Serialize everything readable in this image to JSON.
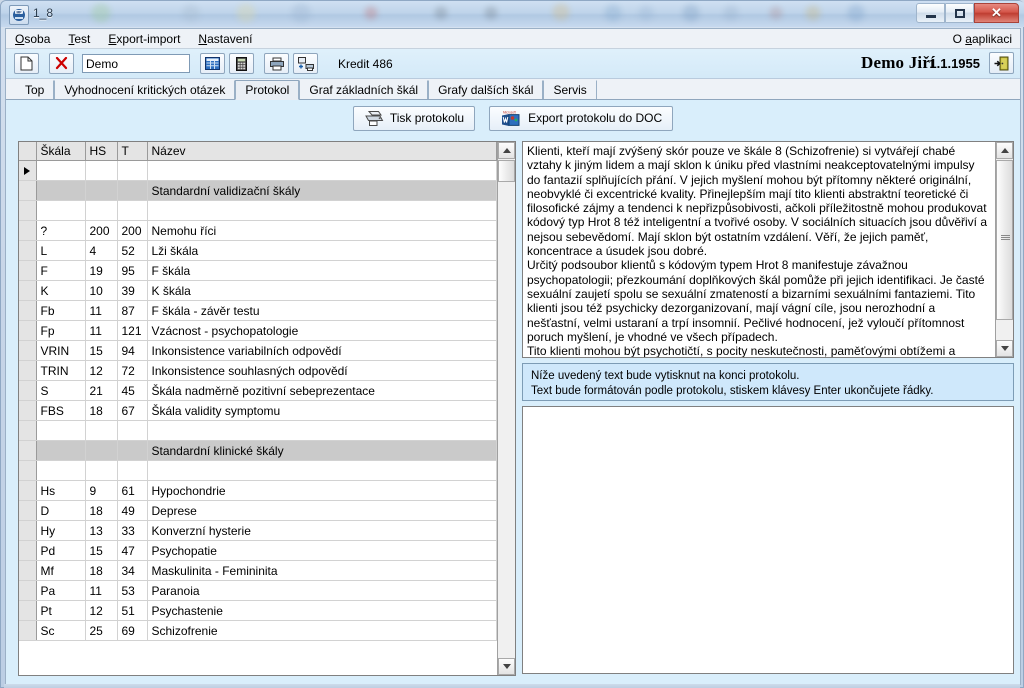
{
  "window": {
    "title": "1_8",
    "app_icon": "mmpi-app-icon",
    "minimize_label": "minimize-icon",
    "maximize_label": "maximize-icon",
    "close_label": "✕"
  },
  "menubar": {
    "items": [
      {
        "label": "Osoba",
        "accel": "O"
      },
      {
        "label": "Test",
        "accel": "T"
      },
      {
        "label": "Export-import",
        "accel": "E"
      },
      {
        "label": "Nastavení",
        "accel": "N"
      }
    ],
    "right_item": "O aplikaci"
  },
  "toolbar": {
    "new_icon": "new-document-icon",
    "delete_icon": "delete-cross-icon",
    "person_value": "Demo",
    "person_placeholder": "Demo",
    "grid_icon": "table-grid-icon",
    "calc_icon": "calculator-icon",
    "print_icon": "printer-icon",
    "print_setup_icon": "printer-setup-icon",
    "credit_label": "Kredit 486",
    "client_name": "Demo Jiří",
    "client_dob": "1.1.1955",
    "exit_icon": "exit-door-icon"
  },
  "tabs": [
    {
      "label": "Top",
      "active": false
    },
    {
      "label": "Vyhodnocení kritických otázek",
      "active": false
    },
    {
      "label": "Protokol",
      "active": true
    },
    {
      "label": "Graf základních škál",
      "active": false
    },
    {
      "label": "Grafy dalších škál",
      "active": false
    },
    {
      "label": "Servis",
      "active": false
    }
  ],
  "actions": {
    "print_protocol": {
      "label": "Tisk protokolu",
      "icon": "printer-icon"
    },
    "export_doc": {
      "label": "Export protokolu do DOC",
      "icon": "msword-icon"
    }
  },
  "grid": {
    "columns": [
      "Škála",
      "HS",
      "T",
      "Název"
    ],
    "rows": [
      {
        "type": "current",
        "scale": "",
        "hs": "",
        "t": "",
        "name": ""
      },
      {
        "type": "section",
        "scale": "",
        "hs": "",
        "t": "",
        "name": "Standardní validizační škály"
      },
      {
        "type": "blank",
        "scale": "",
        "hs": "",
        "t": "",
        "name": ""
      },
      {
        "type": "data",
        "scale": "?",
        "hs": "200",
        "t": "200",
        "name": "Nemohu říci"
      },
      {
        "type": "data",
        "scale": "L",
        "hs": "4",
        "t": "52",
        "name": "Lži škála"
      },
      {
        "type": "data",
        "scale": "F",
        "hs": "19",
        "t": "95",
        "name": "F škála"
      },
      {
        "type": "data",
        "scale": "K",
        "hs": "10",
        "t": "39",
        "name": "K škála"
      },
      {
        "type": "data",
        "scale": "Fb",
        "hs": "11",
        "t": "87",
        "name": "F škála - závěr testu"
      },
      {
        "type": "data",
        "scale": "Fp",
        "hs": "11",
        "t": "121",
        "name": "Vzácnost - psychopatologie"
      },
      {
        "type": "data",
        "scale": "VRIN",
        "hs": "15",
        "t": "94",
        "name": "Inkonsistence variabilních odpovědí"
      },
      {
        "type": "data",
        "scale": "TRIN",
        "hs": "12",
        "t": "72",
        "name": "Inkonsistence souhlasných odpovědí"
      },
      {
        "type": "data",
        "scale": "S",
        "hs": "21",
        "t": "45",
        "name": "Škála nadměrně pozitivní sebeprezentace"
      },
      {
        "type": "data",
        "scale": "FBS",
        "hs": "18",
        "t": "67",
        "name": "Škála validity symptomu"
      },
      {
        "type": "blank",
        "scale": "",
        "hs": "",
        "t": "",
        "name": ""
      },
      {
        "type": "section",
        "scale": "",
        "hs": "",
        "t": "",
        "name": "Standardní klinické škály"
      },
      {
        "type": "blank",
        "scale": "",
        "hs": "",
        "t": "",
        "name": ""
      },
      {
        "type": "data",
        "scale": "Hs",
        "hs": "9",
        "t": "61",
        "name": "Hypochondrie"
      },
      {
        "type": "data",
        "scale": "D",
        "hs": "18",
        "t": "49",
        "name": "Deprese"
      },
      {
        "type": "data",
        "scale": "Hy",
        "hs": "13",
        "t": "33",
        "name": "Konverzní hysterie"
      },
      {
        "type": "data",
        "scale": "Pd",
        "hs": "15",
        "t": "47",
        "name": "Psychopatie"
      },
      {
        "type": "data",
        "scale": "Mf",
        "hs": "18",
        "t": "34",
        "name": "Maskulinita - Femininita"
      },
      {
        "type": "data",
        "scale": "Pa",
        "hs": "11",
        "t": "53",
        "name": "Paranoia"
      },
      {
        "type": "data",
        "scale": "Pt",
        "hs": "12",
        "t": "51",
        "name": "Psychastenie"
      },
      {
        "type": "data",
        "scale": "Sc",
        "hs": "25",
        "t": "69",
        "name": "Schizofrenie"
      }
    ]
  },
  "memo": {
    "paragraphs": [
      "Klienti, kteří mají zvýšený skór pouze ve škále 8 (Schizofrenie) si vytvářejí chabé vztahy k jiným lidem a mají sklon k úniku před vlastními neakceptovatelnými impulsy do fantazií splňujících přání. V jejich myšlení mohou být přítomny některé originální, neobvyklé či excentrické kvality. Přinejlepším mají tito klienti abstraktní teoretické či filosofické zájmy a tendenci k nepřizpůsobivosti, ačkoli příležitostně mohou produkovat kódový typ Hrot 8 též inteligentní a tvořivé osoby. V sociálních situacích jsou důvěřiví a nejsou sebevědomí. Mají sklon být ostatním vzdálení. Věří, že jejich paměť, koncentrace a úsudek jsou dobré.",
      "Určitý podsoubor klientů s kódovým typem Hrot 8 manifestuje závažnou psychopatologii; přezkoumání doplňkových škál pomůže při jejich identifikaci. Je časté sexuální zaujetí spolu se sexuální zmateností a bizarními sexuálními fantaziemi. Tito klienti jsou též psychicky dezorganizovaní, mají vágní cíle, jsou nerozhodní a nešťastní, velmi ustaraní a trpí insomnií. Pečlivé hodnocení, jež vyloučí přítomnost poruch myšlení, je vhodné ve všech případech.",
      "Tito klienti mohou být psychotičtí, s pocity neskutečnosti, paměťovými obtížemi a zmatení či s bizarními myšlenkami a přesvědčeními. Jsou možné halucinace, psychomotorická retardace a stažení se. V anamnéze těchto klientů je běžná psychiatrická hospitalizace. Chronická a charakterologická povaha problémů reprezentovaných v kódovém typu Hrot 8 nevěstí rovněž nic"
    ]
  },
  "infobox": {
    "line1": "Níže uvedený text bude vytisknut na konci protokolu.",
    "line2": "Text bude formátován podle protokolu, stiskem klávesy Enter ukončujete řádky."
  },
  "note": {
    "value": "",
    "placeholder": ""
  },
  "colors": {
    "toolbar_blue": "#d9eefb",
    "info_blue": "#cfe8fb",
    "section_gray": "#cacaca",
    "header_gray": "#e4e4e4",
    "close_red": "#bf3d31"
  }
}
